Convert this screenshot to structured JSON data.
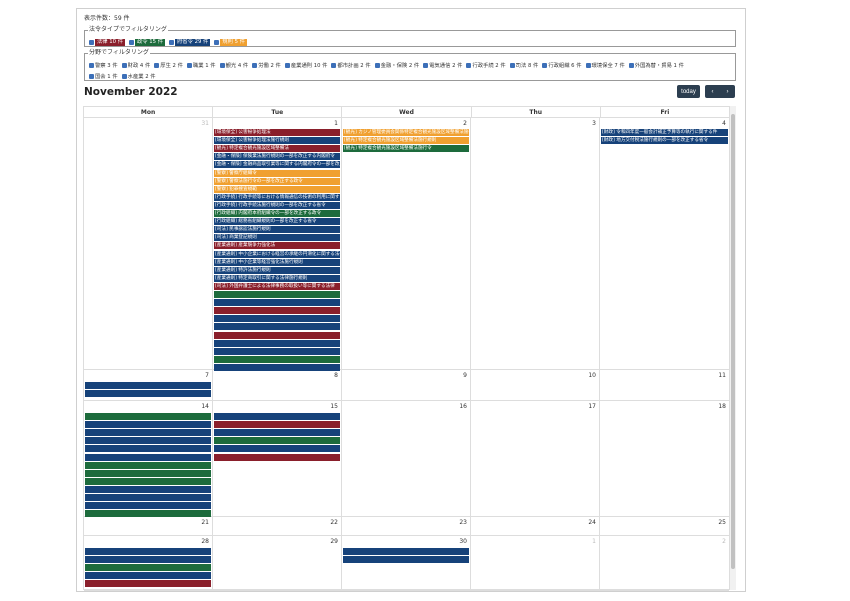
{
  "count_text": "表示件数：59 件",
  "type_filter": {
    "legend": "法令タイプでフィルタリング",
    "items": [
      {
        "label": "法律 10 件",
        "color": "#8a1f2b"
      },
      {
        "label": "政令 15 件",
        "color": "#1d6b3c"
      },
      {
        "label": "府省令 29 件",
        "color": "#16427a"
      },
      {
        "label": "規則 5 件",
        "color": "#f0a030"
      }
    ]
  },
  "category_filter": {
    "legend": "分野でフィルタリング",
    "row1": [
      "警察 3 件",
      "財政 4 件",
      "厚生 2 件",
      "職業 1 件",
      "観光 4 件",
      "労働 2 件",
      "産業通則 10 件",
      "都市計画 2 件",
      "金融・保険 2 件",
      "電気通信 2 件",
      "行政手続 2 件",
      "司法 8 件",
      "行政組織 6 件",
      "環境保全 7 件",
      "外国為替・貿易 1 件"
    ],
    "row2": [
      "国会 1 件",
      "水産業 2 件"
    ]
  },
  "calendar": {
    "title": "November 2022",
    "today_label": "today",
    "prev_label": "‹",
    "next_label": "›",
    "weekdays": [
      "Mon",
      "Tue",
      "Wed",
      "Thu",
      "Fri"
    ],
    "weeks": [
      {
        "days": [
          "31",
          "1",
          "2",
          "3",
          "4"
        ],
        "other": [
          true,
          false,
          false,
          false,
          false
        ]
      },
      {
        "days": [
          "7",
          "8",
          "9",
          "10",
          "11"
        ],
        "other": [
          false,
          false,
          false,
          false,
          false
        ]
      },
      {
        "days": [
          "14",
          "15",
          "16",
          "17",
          "18"
        ],
        "other": [
          false,
          false,
          false,
          false,
          false
        ]
      },
      {
        "days": [
          "21",
          "22",
          "23",
          "24",
          "25"
        ],
        "other": [
          false,
          false,
          false,
          false,
          false
        ]
      },
      {
        "days": [
          "28",
          "29",
          "30",
          "1",
          "2"
        ],
        "other": [
          false,
          false,
          false,
          true,
          true
        ]
      }
    ],
    "events": {
      "w0_tue": [
        {
          "c": "r",
          "t": "[環境保全] 公害紛争処理法"
        },
        {
          "c": "b",
          "t": "[環境保全] 公害紛争処理法施行規則"
        },
        {
          "c": "r",
          "t": "[観光] 特定複合観光施設区域整備法"
        },
        {
          "c": "b",
          "t": "[金融・保険] 保険業法施行規則の一部を改正する内閣府令"
        },
        {
          "c": "b",
          "t": "[金融・保険] 金融商品取引業等に関する内閣府令の一部を改正する内閣府令"
        },
        {
          "c": "o",
          "t": "[警察] 警察庁組織令"
        },
        {
          "c": "o",
          "t": "[警察] 警察法施行令の一部を改正する政令"
        },
        {
          "c": "o",
          "t": "[警察] 犯罪捜査規範"
        },
        {
          "c": "b",
          "t": "[行政手続] 行政手続等における情報通信の技術の利用に関する法律"
        },
        {
          "c": "b",
          "t": "[行政手続] 行政手続法施行規則の一部を改正する省令"
        },
        {
          "c": "g",
          "t": "[行政組織] 内閣府本府組織令の一部を改正する政令"
        },
        {
          "c": "b",
          "t": "[行政組織] 総務省組織規則の一部を改正する省令"
        },
        {
          "c": "b",
          "t": "[司法] 民事訴訟法施行規則"
        },
        {
          "c": "b",
          "t": "[司法] 商業登記規則"
        },
        {
          "c": "r",
          "t": "[産業通則] 産業競争力強化法"
        },
        {
          "c": "b",
          "t": "[産業通則] 中小企業における経営の承継の円滑化に関する法律施行規則"
        },
        {
          "c": "b",
          "t": "[産業通則] 中小企業等経営強化法施行規則"
        },
        {
          "c": "b",
          "t": "[産業通則] 特許法施行規則"
        },
        {
          "c": "b",
          "t": "[産業通則] 特定商取引に関する法律施行規則"
        },
        {
          "c": "r",
          "t": "[司法] 外国弁護士による法律事務の取扱い等に関する法律"
        },
        {
          "c": "g",
          "t": ""
        },
        {
          "c": "b",
          "t": ""
        },
        {
          "c": "r",
          "t": ""
        },
        {
          "c": "b",
          "t": ""
        },
        {
          "c": "b",
          "t": ""
        },
        {
          "c": "r",
          "t": ""
        },
        {
          "c": "b",
          "t": ""
        },
        {
          "c": "b",
          "t": ""
        },
        {
          "c": "g",
          "t": ""
        },
        {
          "c": "b",
          "t": ""
        }
      ],
      "w0_wed": [
        {
          "c": "o",
          "t": "[観光] カジノ管理委員会関係特定複合観光施設区域整備法施行規則"
        },
        {
          "c": "o",
          "t": "[観光] 特定複合観光施設区域整備法施行規則"
        },
        {
          "c": "g",
          "t": "[観光] 特定複合観光施設区域整備法施行令"
        }
      ],
      "w0_fri": [
        {
          "c": "b",
          "t": "[財政] 令和四年度一般会計補正予算等の執行に関する件"
        },
        {
          "c": "b",
          "t": "[財政] 地方交付税法施行規則の一部を改正する省令"
        }
      ],
      "w1_mon": [
        {
          "c": "b",
          "t": ""
        },
        {
          "c": "b",
          "t": ""
        }
      ],
      "w2_mon": [
        {
          "c": "g",
          "t": ""
        },
        {
          "c": "b",
          "t": ""
        },
        {
          "c": "b",
          "t": ""
        },
        {
          "c": "b",
          "t": ""
        },
        {
          "c": "b",
          "t": ""
        },
        {
          "c": "b",
          "t": ""
        },
        {
          "c": "g",
          "t": ""
        },
        {
          "c": "g",
          "t": ""
        },
        {
          "c": "g",
          "t": ""
        },
        {
          "c": "b",
          "t": ""
        },
        {
          "c": "b",
          "t": ""
        },
        {
          "c": "b",
          "t": ""
        },
        {
          "c": "g",
          "t": ""
        }
      ],
      "w2_tue": [
        {
          "c": "b",
          "t": ""
        },
        {
          "c": "r",
          "t": ""
        },
        {
          "c": "b",
          "t": ""
        },
        {
          "c": "g",
          "t": ""
        },
        {
          "c": "b",
          "t": ""
        },
        {
          "c": "r",
          "t": ""
        }
      ],
      "w4_mon": [
        {
          "c": "b",
          "t": ""
        },
        {
          "c": "b",
          "t": ""
        },
        {
          "c": "g",
          "t": ""
        },
        {
          "c": "b",
          "t": ""
        },
        {
          "c": "r",
          "t": ""
        }
      ],
      "w4_wed": [
        {
          "c": "b",
          "t": ""
        },
        {
          "c": "b",
          "t": ""
        }
      ]
    }
  }
}
